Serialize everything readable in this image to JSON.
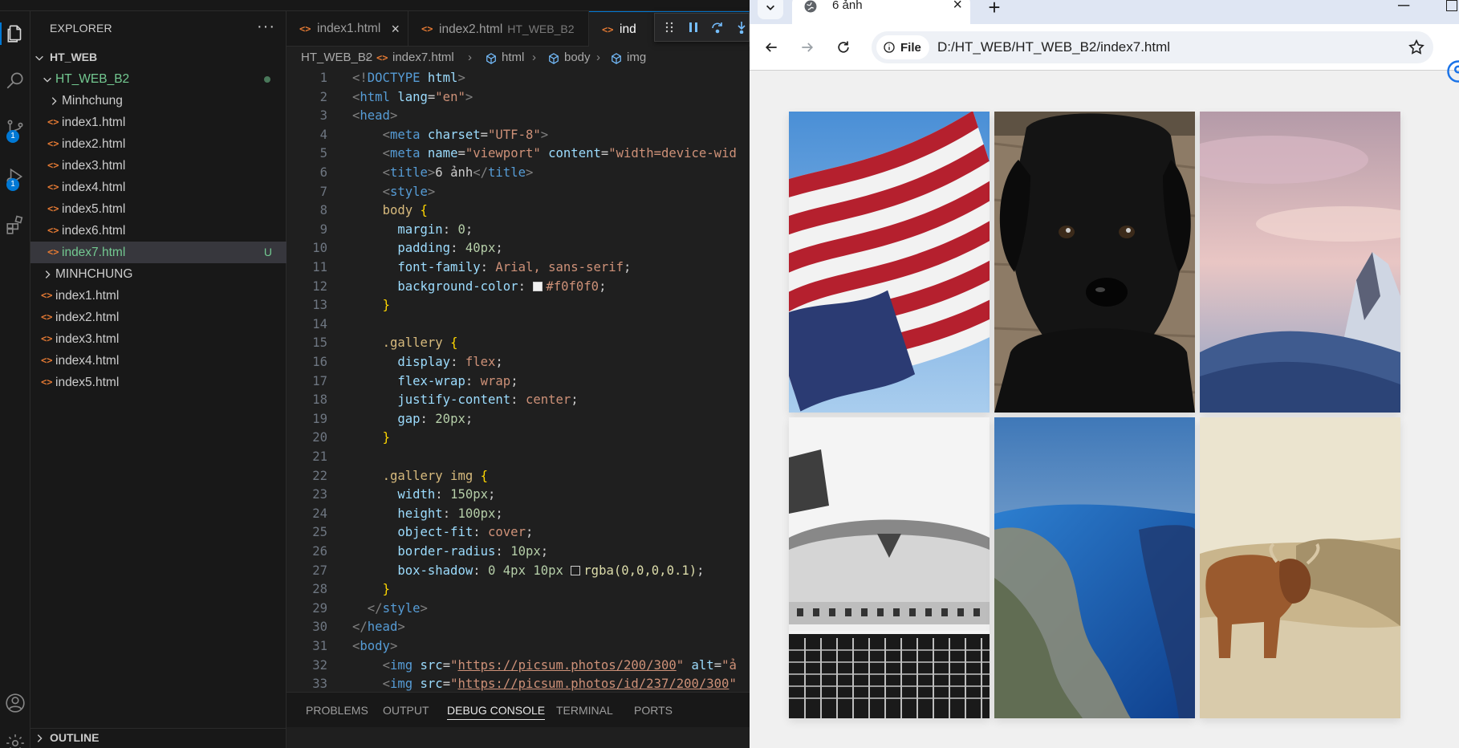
{
  "vscode": {
    "explorer": {
      "title": "EXPLORER",
      "more": "···",
      "root": "HT_WEB",
      "folder": "HT_WEB_B2",
      "subfolder": "Minhchung",
      "files_b2": [
        "index1.html",
        "index2.html",
        "index3.html",
        "index4.html",
        "index5.html",
        "index6.html",
        "index7.html"
      ],
      "selected_badge": "U",
      "folder2": "MINHCHUNG",
      "files_root": [
        "index1.html",
        "index2.html",
        "index3.html",
        "index4.html",
        "index5.html"
      ],
      "outline": "OUTLINE"
    },
    "activity_badges": [
      "1",
      "1"
    ],
    "tabs": [
      {
        "label": "index1.html",
        "close": "×"
      },
      {
        "label": "index2.html",
        "desc": "HT_WEB_B2"
      },
      {
        "label": "ind"
      }
    ],
    "breadcrumb": [
      "HT_WEB_B2",
      "index7.html",
      "html",
      "body",
      "img"
    ],
    "line_numbers": [
      "1",
      "2",
      "3",
      "4",
      "5",
      "6",
      "7",
      "8",
      "9",
      "10",
      "11",
      "12",
      "13",
      "14",
      "15",
      "16",
      "17",
      "18",
      "19",
      "20",
      "21",
      "22",
      "23",
      "24",
      "25",
      "26",
      "27",
      "28",
      "29",
      "30",
      "31",
      "32",
      "33"
    ],
    "code": {
      "l1_doctype": "DOCTYPE",
      "l1_html": "html",
      "l2_lang": "\"en\"",
      "l4_charset": "\"UTF-8\"",
      "l5_name": "\"viewport\"",
      "l5_content": "\"width=device-wid",
      "l6_title_text": "6 ảnh",
      "l8_sel": "body",
      "l9_val": "0",
      "l10_val": "40px",
      "l11_val": "Arial, sans-serif",
      "l12_val": "#f0f0f0",
      "l15_sel": ".gallery",
      "l16_val": "flex",
      "l17_val": "wrap",
      "l18_val": "center",
      "l19_val": "20px",
      "l22_sel": ".gallery img",
      "l23_val": "150px",
      "l24_val": "100px",
      "l25_val": "cover",
      "l26_val": "10px",
      "l27_val": "0 4px 10px",
      "l27_func": "rgba(0,0,0,0.1)",
      "l32_src": "https://picsum.photos/200/300",
      "l32_alt": "\"ả",
      "l33_src": "https://picsum.photos/id/237/200/300"
    },
    "panel_tabs": [
      "PROBLEMS",
      "OUTPUT",
      "DEBUG CONSOLE",
      "TERMINAL",
      "PORTS"
    ],
    "panel_active": "DEBUG CONSOLE"
  },
  "browser": {
    "tab_title": "6 ảnh",
    "tab_close": "×",
    "new_tab": "+",
    "chip": "File",
    "url": "D:/HT_WEB/HT_WEB_B2/index7.html",
    "page_background": "#f0f0f0",
    "gallery_images": [
      {
        "subject": "american-flag"
      },
      {
        "subject": "black-puppy"
      },
      {
        "subject": "snowy-mountain-sunset"
      },
      {
        "subject": "vintage-car-bw"
      },
      {
        "subject": "fjord-aerial"
      },
      {
        "subject": "highland-cow"
      }
    ]
  },
  "colors": {
    "accent": "#0078d4",
    "git_untracked": "#73c991",
    "html_icon": "#e37933"
  }
}
